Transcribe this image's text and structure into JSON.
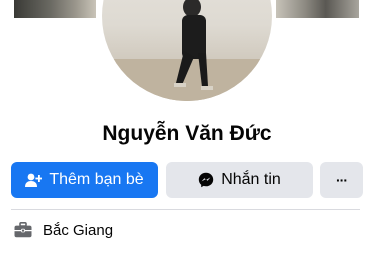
{
  "profile": {
    "name": "Nguyễn Văn Đức"
  },
  "actions": {
    "add_friend_label": "Thêm bạn bè",
    "message_label": "Nhắn tin",
    "more_label": "···"
  },
  "info": {
    "location": "Bắc Giang"
  },
  "icons": {
    "add_friend": "add-friend-icon",
    "messenger": "messenger-icon",
    "more": "more-icon",
    "location": "briefcase-icon"
  },
  "colors": {
    "primary_button": "#1877f2",
    "secondary_button": "#e4e6eb",
    "text": "#050505"
  }
}
